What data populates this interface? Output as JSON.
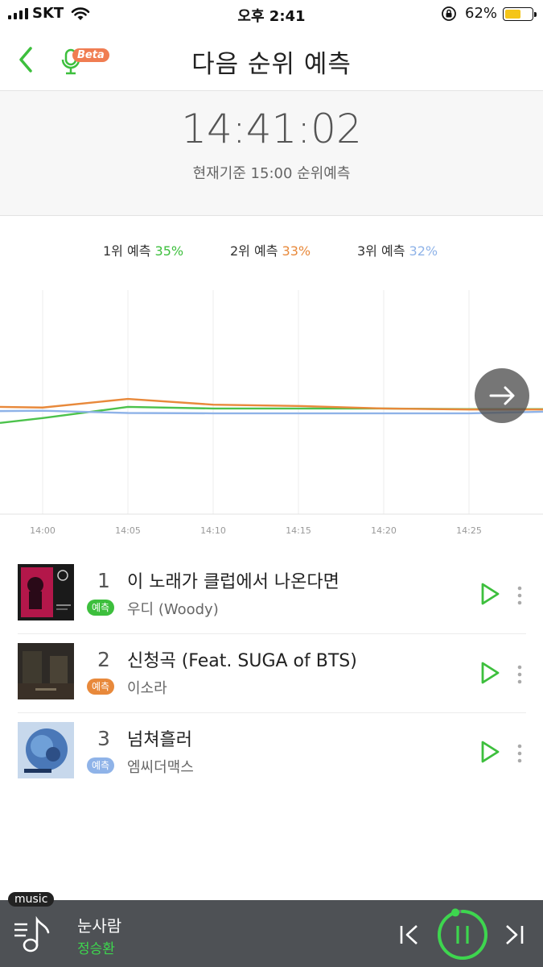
{
  "status": {
    "carrier": "SKT",
    "time": "오후 2:41",
    "battery_pct": "62%",
    "battery_level": 0.62,
    "battery_color": "#f5c518"
  },
  "header": {
    "title": "다음 순위 예측",
    "beta_label": "Beta",
    "back_icon": "chevron-left-icon",
    "voice_icon": "microphone-icon"
  },
  "clock": {
    "time": "14:41:02",
    "subtitle": "현재기준 15:00 순위예측"
  },
  "legend": [
    {
      "label": "1위 예측",
      "pct": "35%",
      "color": "#3dbf3d"
    },
    {
      "label": "2위 예측",
      "pct": "33%",
      "color": "#e8893b"
    },
    {
      "label": "3위 예측",
      "pct": "32%",
      "color": "#8fb3e8"
    }
  ],
  "chart_data": {
    "type": "line",
    "x": [
      "13:57",
      "14:00",
      "14:05",
      "14:10",
      "14:15",
      "14:20",
      "14:25",
      "14:30"
    ],
    "tick_labels": [
      "14:00",
      "14:05",
      "14:10",
      "14:15",
      "14:20",
      "14:25"
    ],
    "series": [
      {
        "name": "1위 예측",
        "color": "#4cc24c",
        "values": [
          28.5,
          30,
          33.5,
          33,
          33,
          33,
          32.8,
          32.8
        ]
      },
      {
        "name": "2위 예측",
        "color": "#e8893b",
        "values": [
          33.5,
          33.3,
          36,
          34.2,
          33.8,
          33,
          32.7,
          32.7
        ]
      },
      {
        "name": "3위 예측",
        "color": "#8fb3e8",
        "values": [
          32.2,
          32.3,
          31.6,
          31.5,
          31.5,
          31.5,
          31.5,
          32
        ]
      }
    ],
    "ylim": [
      0,
      70
    ],
    "grid": true,
    "legend_position": "top-center"
  },
  "next_button_icon": "arrow-right-icon",
  "songs": [
    {
      "rank": "1",
      "title": "이 노래가 클럽에서 나온다면",
      "artist": "우디 (Woody)",
      "badge": "예측",
      "badge_color": "#3dbf3d",
      "cover_colors": [
        "#b3174a",
        "#1a1a1a"
      ]
    },
    {
      "rank": "2",
      "title": "신청곡 (Feat. SUGA of BTS)",
      "artist": "이소라",
      "badge": "예측",
      "badge_color": "#e8893b",
      "cover_colors": [
        "#2e2a26",
        "#4a4336"
      ]
    },
    {
      "rank": "3",
      "title": "넘쳐흘러",
      "artist": "엠씨더맥스",
      "badge": "예측",
      "badge_color": "#8fb3e8",
      "cover_colors": [
        "#4a78b8",
        "#c7d8ec"
      ]
    }
  ],
  "player": {
    "tag": "music",
    "title": "눈사람",
    "artist": "정승환",
    "accent": "#3dd64e",
    "progress": 0.95
  }
}
